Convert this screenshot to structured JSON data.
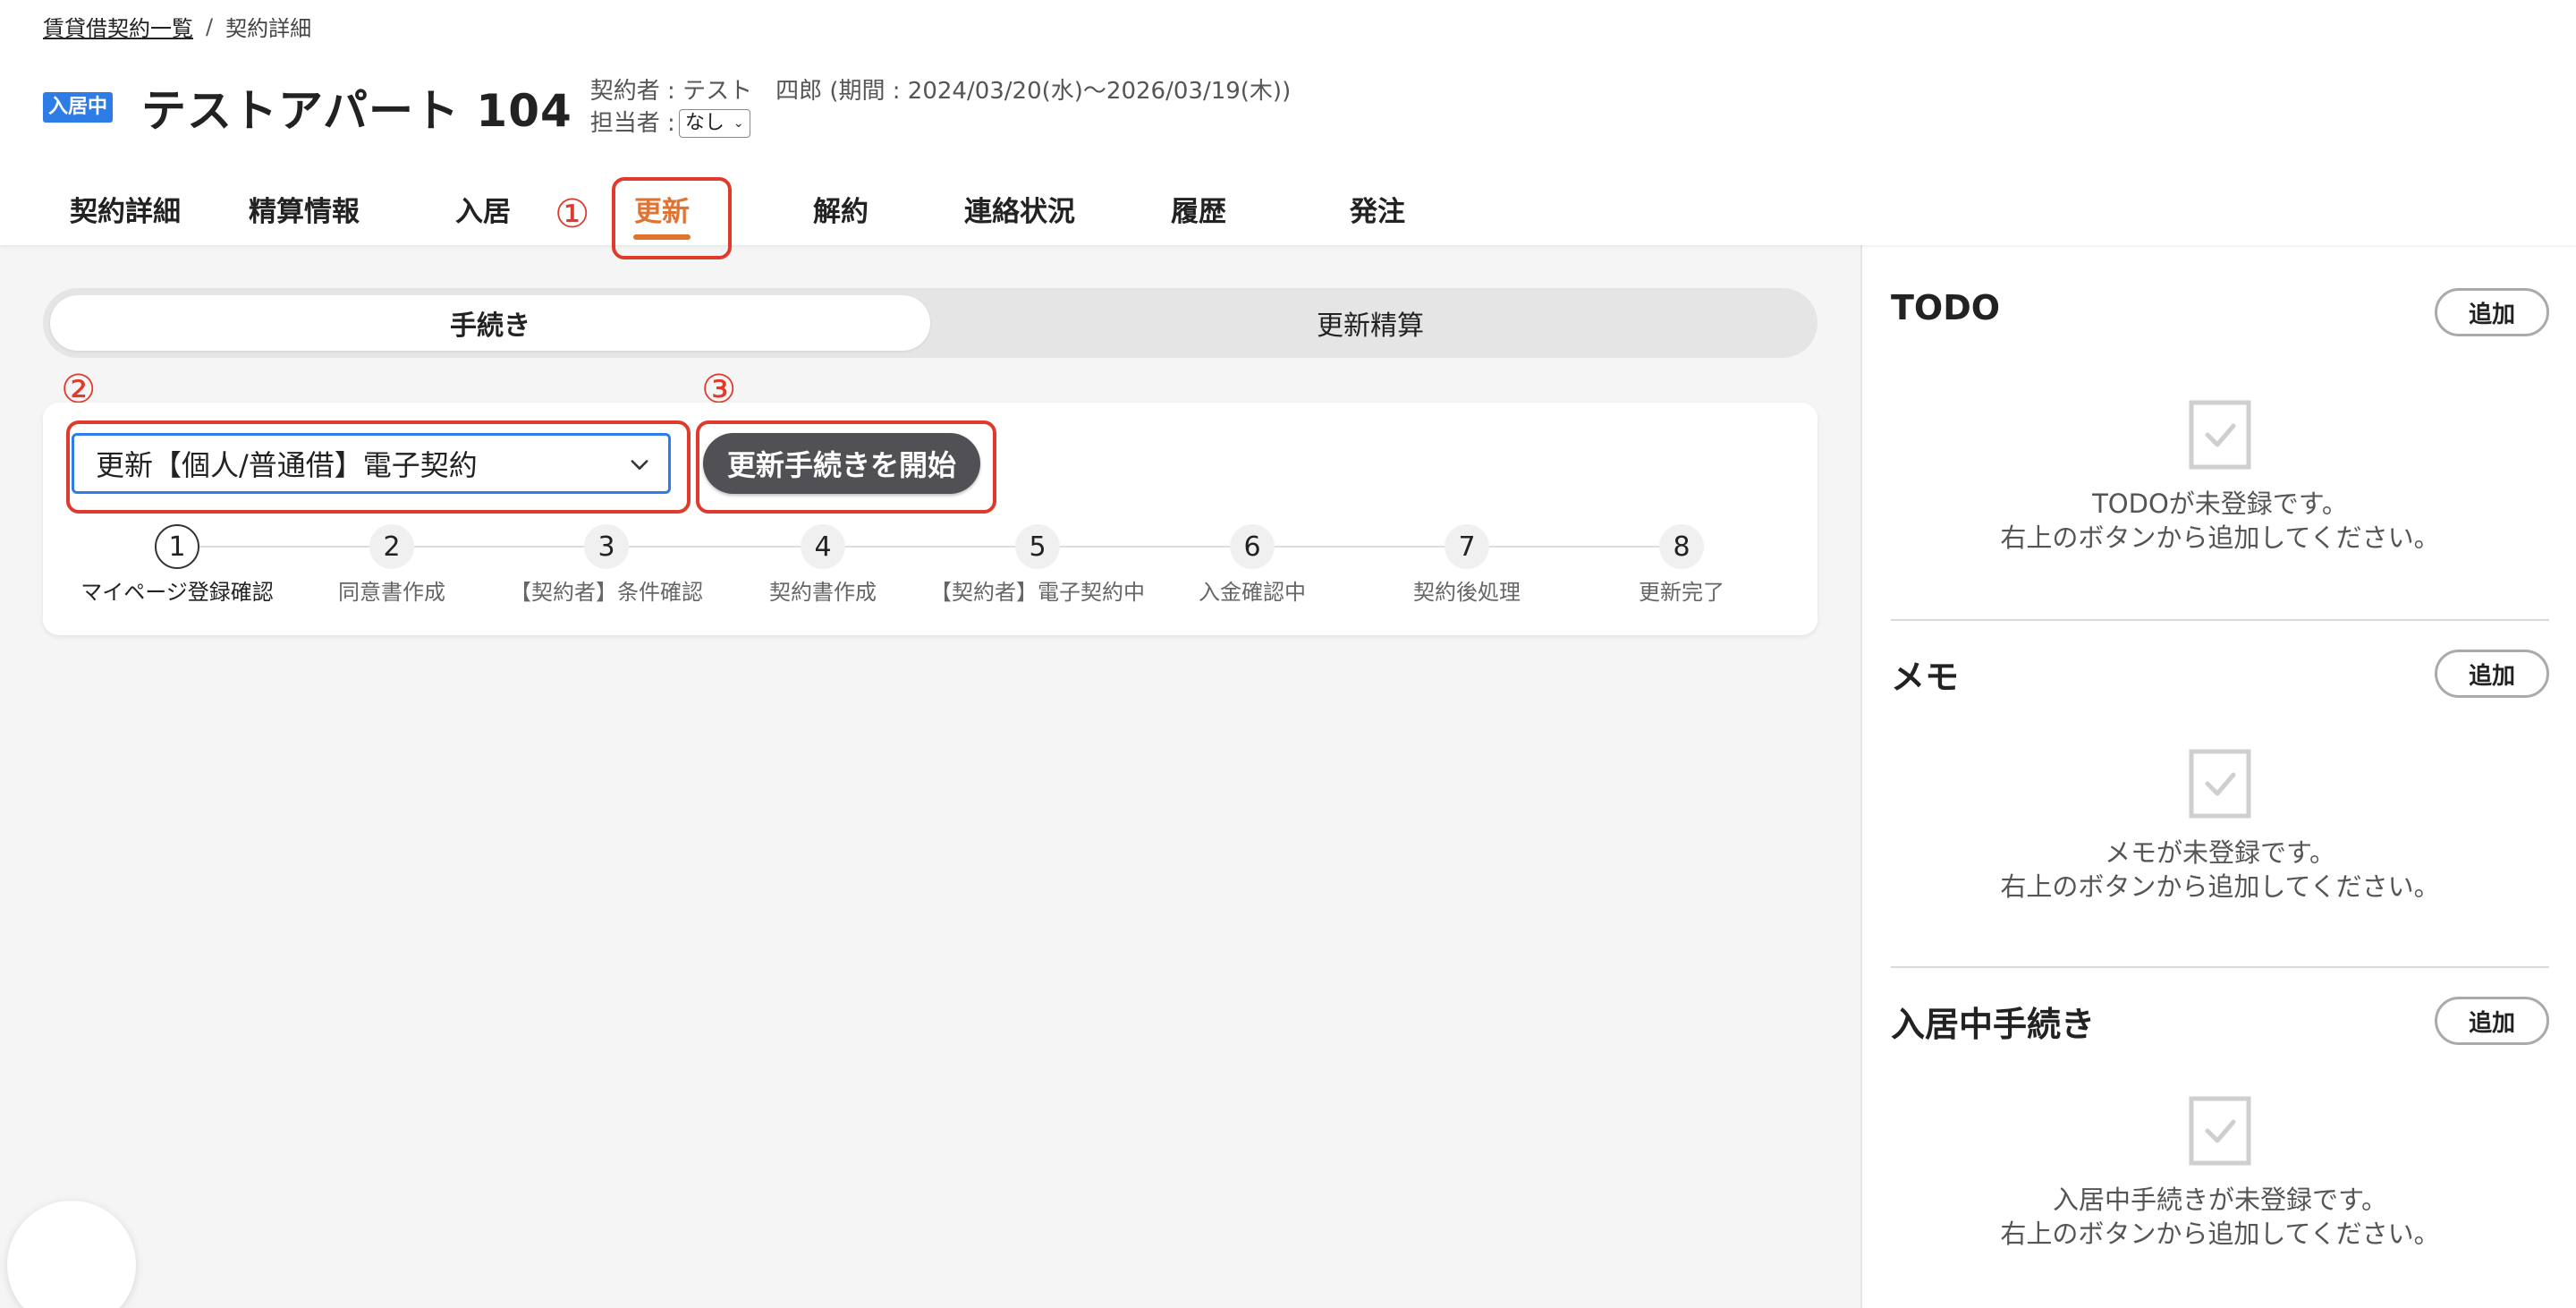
{
  "breadcrumb": {
    "parent": "賃貸借契約一覧",
    "separator": "/",
    "current": "契約詳細"
  },
  "header": {
    "status_badge": "入居中",
    "title": "テストアパート 104",
    "contractor_label": "契約者 : テスト　四郎 (期間 : 2024/03/20(水)〜2026/03/19(木))",
    "assignee_label": "担当者 :",
    "assignee_value": "なし"
  },
  "tabs": [
    {
      "label": "契約詳細",
      "active": false
    },
    {
      "label": "精算情報",
      "active": false
    },
    {
      "label": "入居",
      "active": false
    },
    {
      "label": "更新",
      "active": true
    },
    {
      "label": "解約",
      "active": false
    },
    {
      "label": "連絡状況",
      "active": false
    },
    {
      "label": "履歴",
      "active": false
    },
    {
      "label": "発注",
      "active": false
    }
  ],
  "annotations": {
    "n1": "①",
    "n2": "②",
    "n3": "③"
  },
  "subtabs": [
    {
      "label": "手続き",
      "active": true
    },
    {
      "label": "更新精算",
      "active": false
    }
  ],
  "procedure": {
    "selected": "更新【個人/普通借】電子契約",
    "start_button": "更新手続きを開始"
  },
  "steps": [
    {
      "num": "1",
      "label": "マイページ登録確認",
      "current": true
    },
    {
      "num": "2",
      "label": "同意書作成",
      "current": false
    },
    {
      "num": "3",
      "label": "【契約者】条件確認",
      "current": false
    },
    {
      "num": "4",
      "label": "契約書作成",
      "current": false
    },
    {
      "num": "5",
      "label": "【契約者】電子契約中",
      "current": false
    },
    {
      "num": "6",
      "label": "入金確認中",
      "current": false
    },
    {
      "num": "7",
      "label": "契約後処理",
      "current": false
    },
    {
      "num": "8",
      "label": "更新完了",
      "current": false
    }
  ],
  "sidebar": {
    "todo": {
      "title": "TODO",
      "add": "追加",
      "empty_line1": "TODOが未登録です。",
      "empty_line2": "右上のボタンから追加してください。"
    },
    "memo": {
      "title": "メモ",
      "add": "追加",
      "empty_line1": "メモが未登録です。",
      "empty_line2": "右上のボタンから追加してください。"
    },
    "occupancy": {
      "title": "入居中手続き",
      "add": "追加",
      "empty_line1": "入居中手続きが未登録です。",
      "empty_line2": "右上のボタンから追加してください。"
    }
  },
  "colors": {
    "accent": "#e07330",
    "primary": "#2e7ce6",
    "annotation": "#e03a2c",
    "dark_button": "#505055"
  }
}
